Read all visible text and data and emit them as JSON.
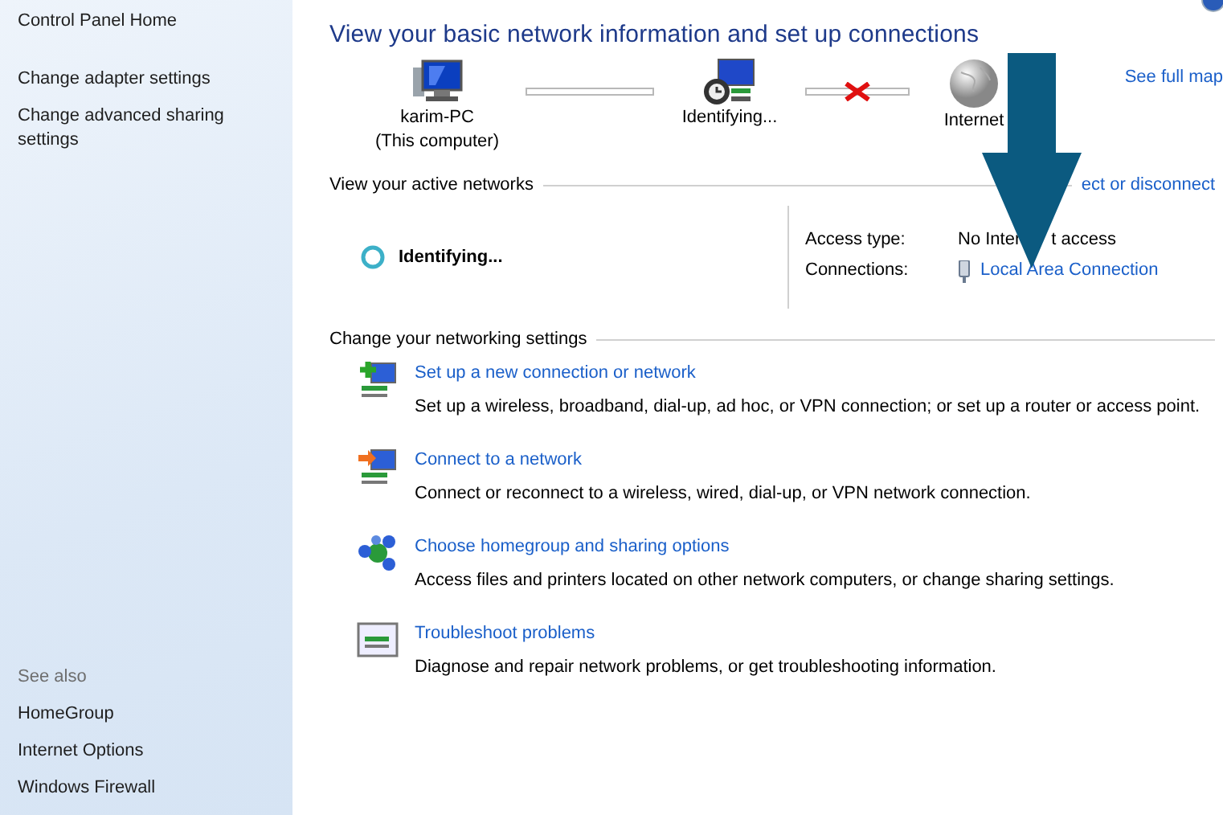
{
  "sidebar": {
    "tasks": [
      "Control Panel Home",
      "Change adapter settings",
      "Change advanced sharing settings"
    ],
    "see_also_heading": "See also",
    "see_also": [
      "HomeGroup",
      "Internet Options",
      "Windows Firewall"
    ]
  },
  "title": "View your basic network information and set up connections",
  "network_map": {
    "nodes": [
      {
        "kind": "computer",
        "label": "karim-PC",
        "sublabel": "(This computer)"
      },
      {
        "kind": "network",
        "label": "Identifying..."
      },
      {
        "kind": "internet",
        "label": "Internet"
      }
    ],
    "links": [
      {
        "kind": "connected"
      },
      {
        "kind": "broken"
      }
    ],
    "see_full_map": "See full map"
  },
  "active_networks": {
    "heading": "View your active networks",
    "link": "ect or disconnect",
    "network": {
      "name": "Identifying...",
      "access_type_label": "Access type:",
      "access_type": [
        "No Inter",
        "t access"
      ],
      "connections_label": "Connections:",
      "connection": "Local Area Connection"
    }
  },
  "settings": {
    "heading": "Change your networking settings",
    "items": [
      {
        "kind": "new-connection",
        "link": "Set up a new connection or network",
        "description": "Set up a wireless, broadband, dial-up, ad hoc, or VPN connection; or set up a router or access point."
      },
      {
        "kind": "connect",
        "link": "Connect to a network",
        "description": "Connect or reconnect to a wireless, wired, dial-up, or VPN network connection."
      },
      {
        "kind": "homegroup",
        "link": "Choose homegroup and sharing options",
        "description": "Access files and printers located on other network computers, or change sharing settings."
      },
      {
        "kind": "troubleshoot",
        "link": "Troubleshoot problems",
        "description": "Diagnose and repair network problems, or get troubleshooting information."
      }
    ]
  }
}
